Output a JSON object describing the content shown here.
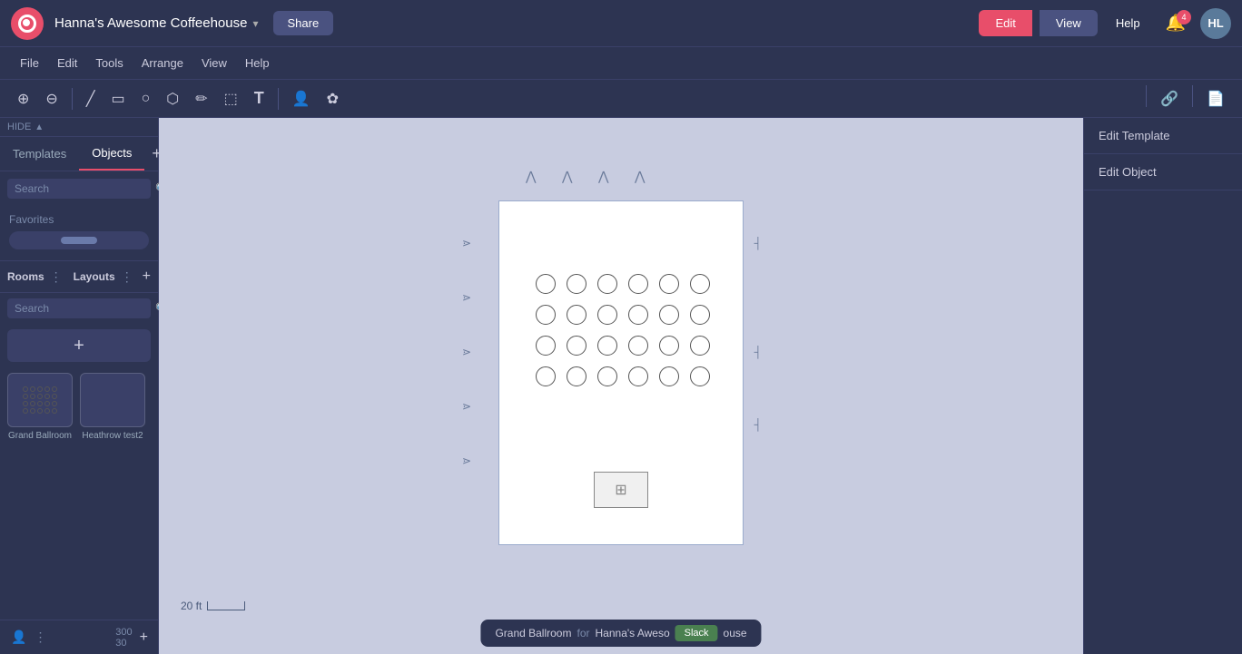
{
  "topNav": {
    "workspaceName": "Hanna's Awesome Coffeehouse",
    "shareLabel": "Share",
    "editLabel": "Edit",
    "viewLabel": "View",
    "helpLabel": "Help",
    "notifCount": "4",
    "avatarInitials": "HL"
  },
  "menuBar": {
    "items": [
      "File",
      "Edit",
      "Tools",
      "Arrange",
      "View",
      "Help"
    ]
  },
  "toolbar": {
    "zoomIn": "+",
    "zoomOut": "−",
    "tools": [
      "line",
      "rect",
      "circle",
      "pen",
      "brush",
      "image",
      "text",
      "person",
      "shape"
    ]
  },
  "leftSidebar": {
    "tabs": [
      "Templates",
      "Objects"
    ],
    "activeTab": "Objects",
    "searchPlaceholder": "Search",
    "favoritesLabel": "Favorites",
    "roomsLabel": "Rooms",
    "layoutsLabel": "Layouts",
    "roomsSearchPlaceholder": "Search"
  },
  "layoutThumbs": [
    {
      "label": "Grand Ballroom"
    },
    {
      "label": "Heathrow test2"
    }
  ],
  "rightSidebar": {
    "editTemplate": "Edit Template",
    "editObject": "Edit Object"
  },
  "canvas": {
    "scaleLabel": "20 ft"
  },
  "statusBar": {
    "roomName": "Grand Ballroom",
    "forText": "for",
    "venueName": "Hanna's Aweso",
    "venueNameFull": "Hanna's Awesome Coffeehouse",
    "slackLabel": "Slack"
  },
  "bottomLeft": {
    "coordX": "300",
    "coordY": "30"
  }
}
